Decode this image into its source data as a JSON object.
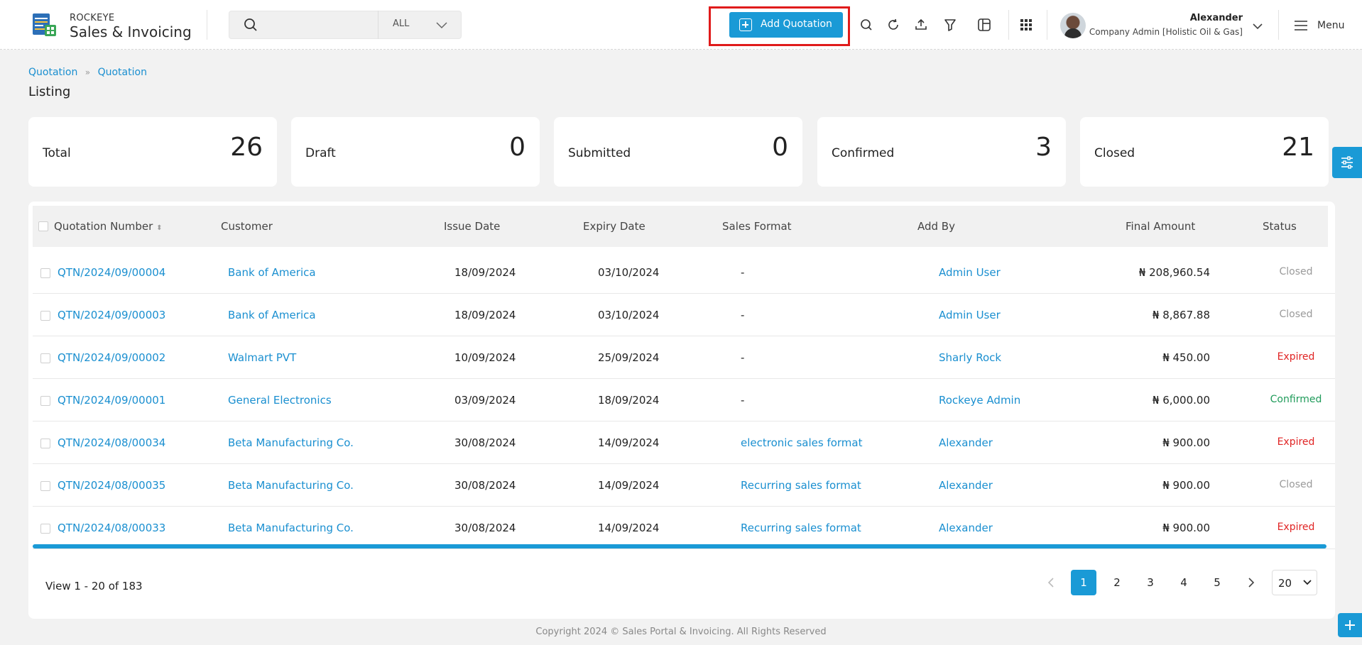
{
  "brand": {
    "small": "ROCKEYE",
    "big": "Sales & Invoicing"
  },
  "search": {
    "value": "",
    "scope": "ALL"
  },
  "header": {
    "add_button": "Add Quotation",
    "user_name": "Alexander",
    "user_role": "Company Admin [Holistic Oil & Gas]",
    "menu_label": "Menu",
    "icons": [
      "search-icon",
      "refresh-icon",
      "upload-icon",
      "filter-icon",
      "columns-icon",
      "apps-grid-icon"
    ]
  },
  "breadcrumb": [
    "Quotation",
    "Quotation"
  ],
  "page_title": "Listing",
  "stats": [
    {
      "label": "Total",
      "value": "26"
    },
    {
      "label": "Draft",
      "value": "0"
    },
    {
      "label": "Submitted",
      "value": "0"
    },
    {
      "label": "Confirmed",
      "value": "3"
    },
    {
      "label": "Closed",
      "value": "21"
    }
  ],
  "table": {
    "columns": [
      "Quotation Number",
      "Customer",
      "Issue Date",
      "Expiry Date",
      "Sales Format",
      "Add By",
      "Final Amount",
      "Status"
    ],
    "rows": [
      {
        "number": "QTN/2024/09/00004",
        "customer": "Bank of America",
        "issue": "18/09/2024",
        "expiry": "03/10/2024",
        "format": "-",
        "add_by": "Admin User",
        "amount": "₦ 208,960.54",
        "status": "Closed"
      },
      {
        "number": "QTN/2024/09/00003",
        "customer": "Bank of America",
        "issue": "18/09/2024",
        "expiry": "03/10/2024",
        "format": "-",
        "add_by": "Admin User",
        "amount": "₦ 8,867.88",
        "status": "Closed"
      },
      {
        "number": "QTN/2024/09/00002",
        "customer": "Walmart PVT",
        "issue": "10/09/2024",
        "expiry": "25/09/2024",
        "format": "-",
        "add_by": "Sharly Rock",
        "amount": "₦ 450.00",
        "status": "Expired"
      },
      {
        "number": "QTN/2024/09/00001",
        "customer": "General Electronics",
        "issue": "03/09/2024",
        "expiry": "18/09/2024",
        "format": "-",
        "add_by": "Rockeye Admin",
        "amount": "₦ 6,000.00",
        "status": "Confirmed"
      },
      {
        "number": "QTN/2024/08/00034",
        "customer": "Beta Manufacturing Co.",
        "issue": "30/08/2024",
        "expiry": "14/09/2024",
        "format": "electronic sales format",
        "add_by": "Alexander",
        "amount": "₦ 900.00",
        "status": "Expired"
      },
      {
        "number": "QTN/2024/08/00035",
        "customer": "Beta Manufacturing Co.",
        "issue": "30/08/2024",
        "expiry": "14/09/2024",
        "format": "Recurring sales format",
        "add_by": "Alexander",
        "amount": "₦ 900.00",
        "status": "Closed"
      },
      {
        "number": "QTN/2024/08/00033",
        "customer": "Beta Manufacturing Co.",
        "issue": "30/08/2024",
        "expiry": "14/09/2024",
        "format": "Recurring sales format",
        "add_by": "Alexander",
        "amount": "₦ 900.00",
        "status": "Expired"
      }
    ]
  },
  "status_colors": {
    "Closed": "#9a9a9a",
    "Expired": "#e02424",
    "Confirmed": "#1f9b5a"
  },
  "pagination": {
    "summary": "View 1 - 20 of 183",
    "pages": [
      "1",
      "2",
      "3",
      "4",
      "5"
    ],
    "active": "1",
    "page_size": "20"
  },
  "footer": "Copyright 2024 © Sales Portal & Invoicing. All Rights Reserved",
  "colors": {
    "accent": "#1a9ad6",
    "highlight": "#e01b1b"
  }
}
